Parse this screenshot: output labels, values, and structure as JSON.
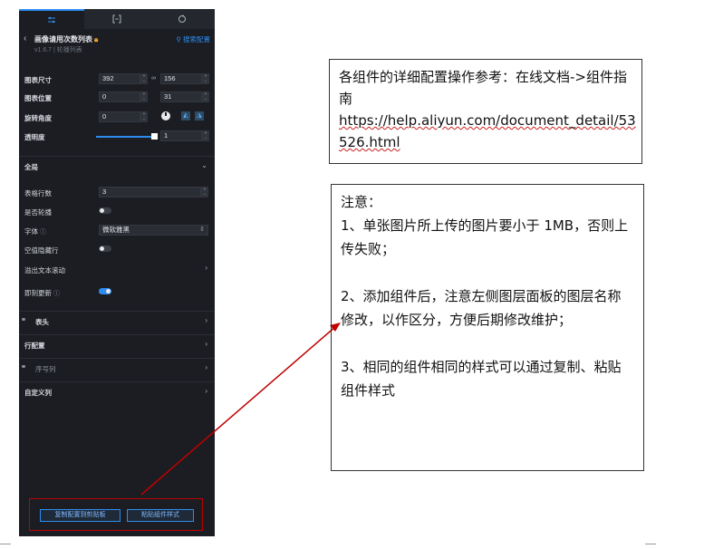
{
  "panel": {
    "tabs": [
      {
        "icon": "sliders-icon",
        "active": true
      },
      {
        "icon": "brackets-icon",
        "active": false
      },
      {
        "icon": "refresh-icon",
        "active": false
      }
    ],
    "title": "画像请用次数列表",
    "title_icon": "lock-icon",
    "search_config": "搜索配置",
    "version": "v1.6.7 | 轮播列表",
    "size_label": "图表尺寸",
    "width": "392",
    "height": "156",
    "position_label": "图表位置",
    "pos_x": "0",
    "pos_y": "31",
    "rotate_label": "旋转角度",
    "rotate_value": "0",
    "opacity_label": "透明度",
    "opacity_value": "1",
    "opacity_level": 1,
    "global_label": "全局",
    "rows_label": "表格行数",
    "rows_value": "3",
    "carousel_label": "是否轮播",
    "carousel_on": false,
    "font_label": "字体",
    "font_value": "微软雅黑",
    "hide_empty_label": "空值隐藏行",
    "hide_empty_on": false,
    "overflow_label": "溢出文本滚动",
    "instant_update_label": "即刻更新",
    "instant_update_on": true,
    "sections": [
      "表头",
      "行配置",
      "序号列",
      "自定义列"
    ],
    "copy_button": "复制配置到剪贴板",
    "paste_button": "粘贴组件样式"
  },
  "note1": {
    "text": "各组件的详细配置操作参考：在线文档->组件指南",
    "url_line1": "https://help.aliyun.com/document_detail/53",
    "url_line2": "526.html"
  },
  "note2": {
    "heading": "注意：",
    "item1": "1、单张图片所上传的图片要小于 1MB，否则上传失败；",
    "item2": "2、添加组件后，注意左侧图层面板的图层名称修改，以作区分，方便后期修改维护；",
    "item3": "3、相同的组件相同的样式可以通过复制、粘贴组件样式"
  },
  "colors": {
    "accent": "#2d8cf0",
    "annotation_red": "#c00000",
    "panel_bg": "#1b1d22"
  }
}
